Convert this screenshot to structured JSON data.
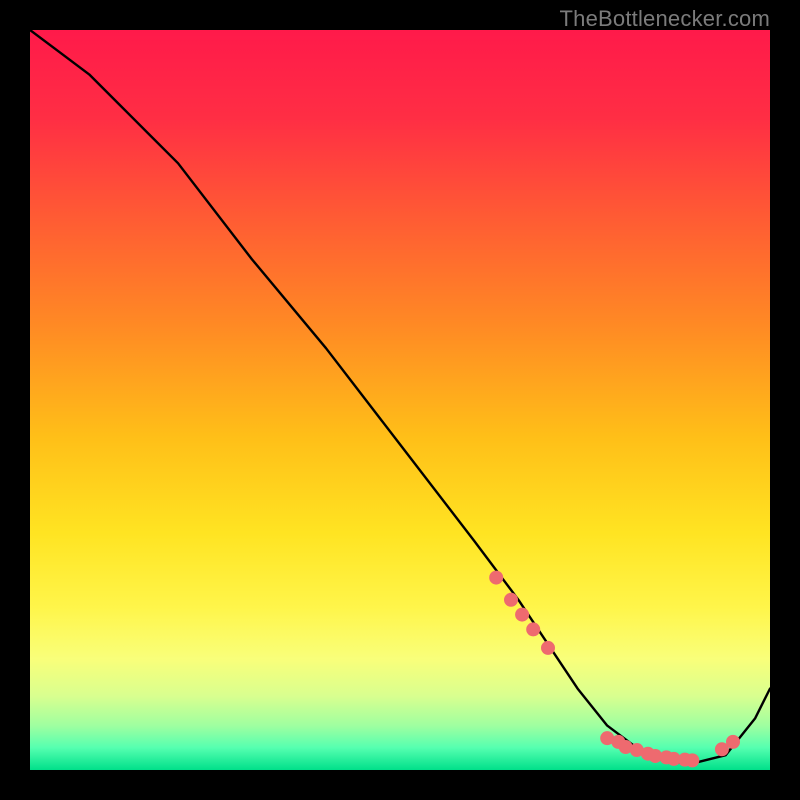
{
  "watermark": "TheBottlenecker.com",
  "gradient": {
    "stops": [
      {
        "offset": 0.0,
        "color": "#ff1a4a"
      },
      {
        "offset": 0.12,
        "color": "#ff2e44"
      },
      {
        "offset": 0.25,
        "color": "#ff5a34"
      },
      {
        "offset": 0.4,
        "color": "#ff8a24"
      },
      {
        "offset": 0.55,
        "color": "#ffbf18"
      },
      {
        "offset": 0.68,
        "color": "#ffe422"
      },
      {
        "offset": 0.78,
        "color": "#fff54a"
      },
      {
        "offset": 0.85,
        "color": "#f9ff7a"
      },
      {
        "offset": 0.9,
        "color": "#d9ff8f"
      },
      {
        "offset": 0.94,
        "color": "#9fffa0"
      },
      {
        "offset": 0.97,
        "color": "#55ffb0"
      },
      {
        "offset": 1.0,
        "color": "#00e08a"
      }
    ]
  },
  "chart_data": {
    "type": "line",
    "title": "",
    "xlabel": "",
    "ylabel": "",
    "xlim": [
      0,
      100
    ],
    "ylim": [
      0,
      100
    ],
    "series": [
      {
        "name": "curve",
        "x": [
          0,
          4,
          8,
          12,
          16,
          20,
          30,
          40,
          50,
          60,
          66,
          70,
          74,
          78,
          82,
          86,
          90,
          94,
          98,
          100
        ],
        "y": [
          100,
          97,
          94,
          90,
          86,
          82,
          69,
          57,
          44,
          31,
          23,
          17,
          11,
          6,
          3,
          1,
          1,
          2,
          7,
          11
        ]
      }
    ],
    "markers": {
      "name": "red-dots",
      "x": [
        63,
        65,
        66.5,
        68,
        70,
        78,
        79.5,
        80.5,
        82,
        83.5,
        84.5,
        86,
        87,
        88.5,
        89.5,
        93.5,
        95
      ],
      "y": [
        26,
        23,
        21,
        19,
        16.5,
        4.3,
        3.8,
        3.1,
        2.7,
        2.2,
        1.9,
        1.7,
        1.5,
        1.4,
        1.3,
        2.8,
        3.8
      ],
      "color": "#ee6a6f",
      "radius": 7
    }
  }
}
